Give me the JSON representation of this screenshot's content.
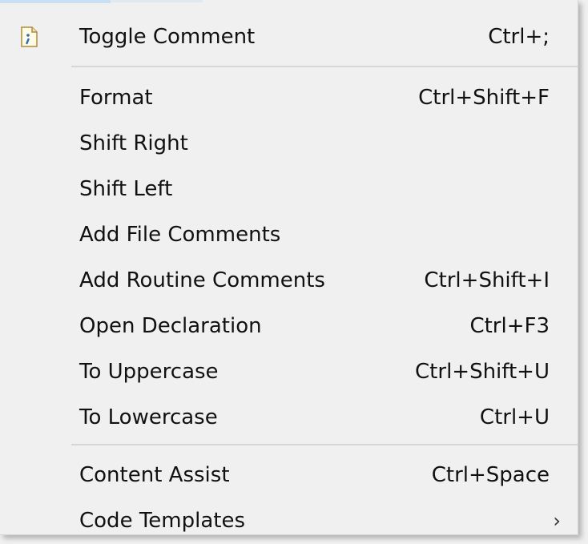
{
  "menu": {
    "items": [
      {
        "label": "Toggle Comment",
        "shortcut": "Ctrl+;",
        "icon": "toggle-comment-icon"
      },
      {
        "label": "Format",
        "shortcut": "Ctrl+Shift+F"
      },
      {
        "label": "Shift Right",
        "shortcut": ""
      },
      {
        "label": "Shift Left",
        "shortcut": ""
      },
      {
        "label": "Add File Comments",
        "shortcut": ""
      },
      {
        "label": "Add Routine Comments",
        "shortcut": "Ctrl+Shift+I"
      },
      {
        "label": "Open Declaration",
        "shortcut": "Ctrl+F3"
      },
      {
        "label": "To Uppercase",
        "shortcut": "Ctrl+Shift+U"
      },
      {
        "label": "To Lowercase",
        "shortcut": "Ctrl+U"
      },
      {
        "label": "Content Assist",
        "shortcut": "Ctrl+Space"
      },
      {
        "label": "Code Templates",
        "shortcut": "",
        "submenu": true
      }
    ],
    "submenu_arrow": "›"
  },
  "colors": {
    "background": "#f0f0f0",
    "separator": "#d6d6d6",
    "text": "#111111",
    "icon_accent": "#2a6fb5"
  }
}
